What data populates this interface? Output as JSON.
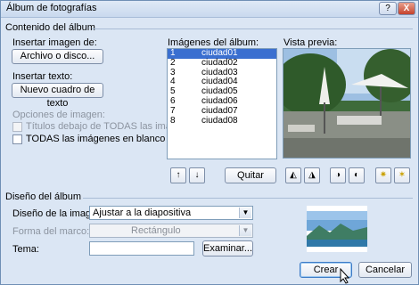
{
  "window": {
    "title": "Álbum de fotografías",
    "help_glyph": "?",
    "close_glyph": "X"
  },
  "content_section": {
    "title": "Contenido del álbum",
    "insert_image_label": "Insertar imagen de:",
    "file_disk_button": "Archivo o disco...",
    "insert_text_label": "Insertar texto:",
    "new_textbox_button": "Nuevo cuadro de texto",
    "image_options_label": "Opciones de imagen:",
    "captions_below_label": "Títulos debajo de TODAS las imágenes",
    "captions_below_checked": false,
    "captions_below_enabled": false,
    "all_bw_label": "TODAS las imágenes en blanco y negro",
    "all_bw_checked": false
  },
  "album_images": {
    "label": "Imágenes del álbum:",
    "items": [
      {
        "num": "1",
        "name": "ciudad01",
        "selected": true
      },
      {
        "num": "2",
        "name": "ciudad02"
      },
      {
        "num": "3",
        "name": "ciudad03"
      },
      {
        "num": "4",
        "name": "ciudad04"
      },
      {
        "num": "5",
        "name": "ciudad05"
      },
      {
        "num": "6",
        "name": "ciudad06"
      },
      {
        "num": "7",
        "name": "ciudad07"
      },
      {
        "num": "8",
        "name": "ciudad08"
      }
    ],
    "move_up_glyph": "↑",
    "move_down_glyph": "↓",
    "remove_button": "Quitar"
  },
  "preview": {
    "label": "Vista previa:"
  },
  "image_tool_icons": [
    "rotate-left-icon",
    "rotate-right-icon",
    "contrast-more-icon",
    "contrast-less-icon",
    "brightness-more-icon",
    "brightness-less-icon"
  ],
  "layout_section": {
    "title": "Diseño del álbum",
    "picture_layout_label": "Diseño de la imagen:",
    "picture_layout_value": "Ajustar a la diapositiva",
    "frame_shape_label": "Forma del marco:",
    "frame_shape_value": "Rectángulo",
    "frame_shape_enabled": false,
    "theme_label": "Tema:",
    "theme_value": "",
    "browse_button": "Examinar..."
  },
  "footer": {
    "create_button": "Crear",
    "cancel_button": "Cancelar"
  },
  "colors": {
    "dialog_bg": "#dbe6f4",
    "selection": "#3a6fd0",
    "close_button": "#c5422c"
  }
}
